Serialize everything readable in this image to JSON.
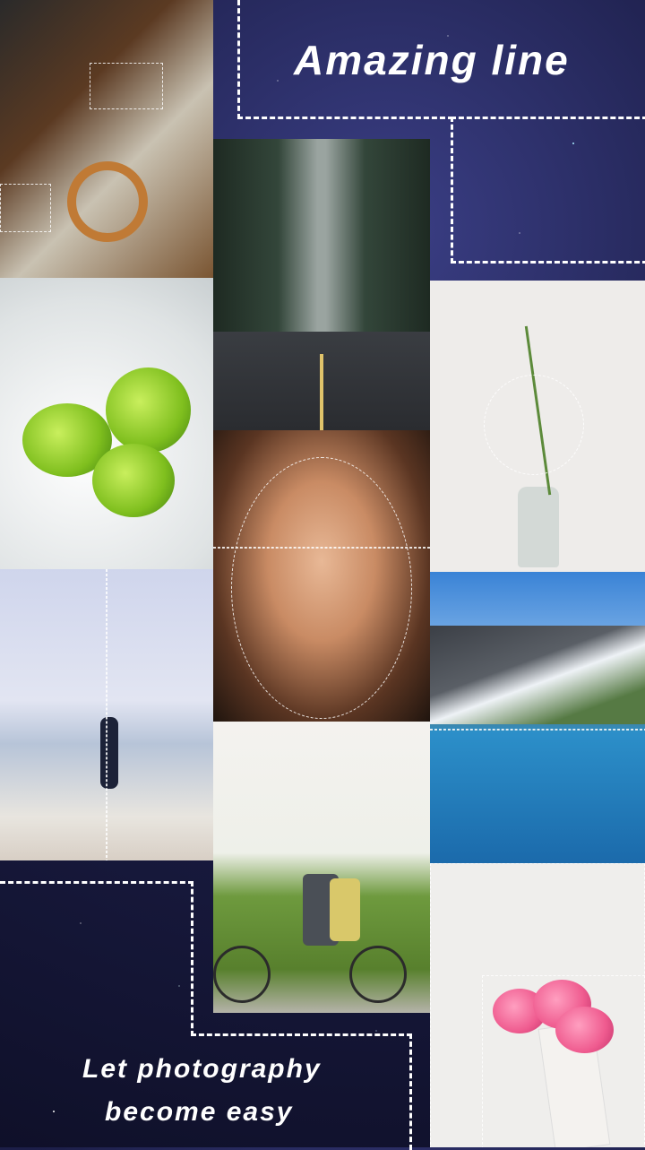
{
  "headline": {
    "title": "Amazing line",
    "subtitle_line1": "Let photography",
    "subtitle_line2": "become easy"
  },
  "colors": {
    "background": "#1d1f4a",
    "text": "#ffffff",
    "dashed_guide": "#ffffff"
  },
  "photos": [
    {
      "subject": "food-platter"
    },
    {
      "subject": "forest-road"
    },
    {
      "subject": "limes"
    },
    {
      "subject": "plant-in-bottle"
    },
    {
      "subject": "portrait"
    },
    {
      "subject": "beach-woman"
    },
    {
      "subject": "mountain-lake"
    },
    {
      "subject": "tandem-bicycle"
    },
    {
      "subject": "pink-roses"
    }
  ]
}
